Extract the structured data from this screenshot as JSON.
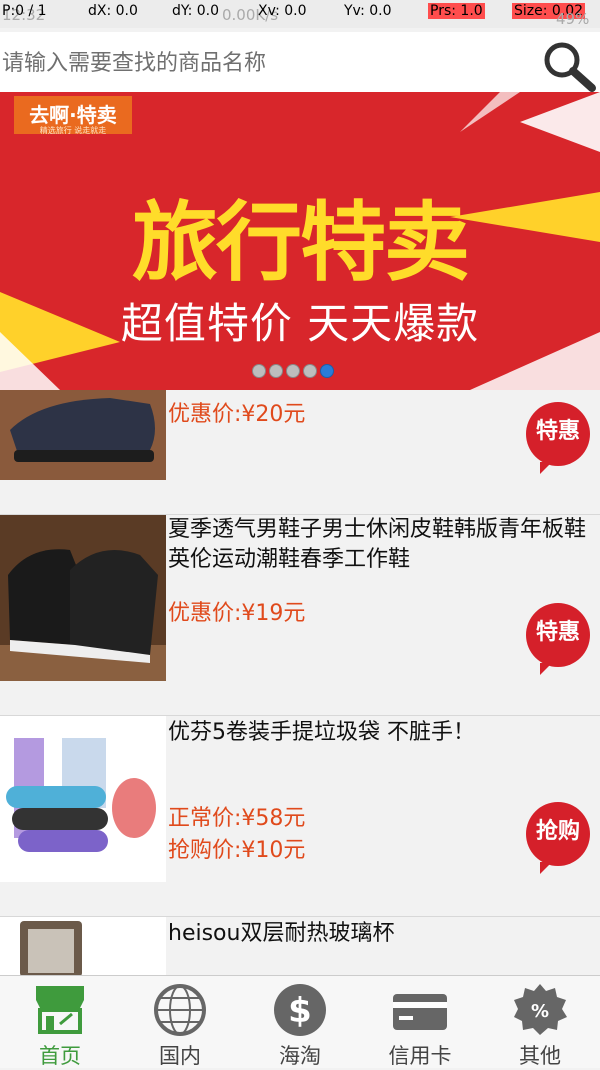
{
  "status_bar": {
    "p": "P:0 / 1",
    "dx": "dX: 0.0",
    "dy": "dY: 0.0",
    "xv": "Xv: 0.0",
    "yv": "Yv: 0.0",
    "prs": "Prs: 1.0",
    "size": "Size: 0.02",
    "time": "12:32",
    "net": "0.00K/s",
    "battery": "49%"
  },
  "search": {
    "placeholder": "请输入需要查找的商品名称"
  },
  "banner": {
    "logo": "去啊·特卖",
    "logo_sub": "精选旅行 说走就走",
    "title": "旅行特卖",
    "subtitle": "超值特价 天天爆款",
    "dots": 5,
    "active_dot": 5
  },
  "items": [
    {
      "name": "",
      "price1": "优惠价:¥20元",
      "price2": "",
      "badge": "特惠"
    },
    {
      "name": "夏季透气男鞋子男士休闲皮鞋韩版青年板鞋英伦运动潮鞋春季工作鞋",
      "price1": "优惠价:¥19元",
      "price2": "",
      "badge": "特惠"
    },
    {
      "name": "优芬5卷装手提垃圾袋 不脏手！",
      "price1": "正常价:¥58元",
      "price2": "抢购价:¥10元",
      "badge": "抢购"
    },
    {
      "name": "heisou双层耐热玻璃杯",
      "price1": "",
      "price2": "",
      "badge": ""
    }
  ],
  "tabs": [
    {
      "label": "首页",
      "icon": "store-icon",
      "active": true
    },
    {
      "label": "国内",
      "icon": "globe-icon",
      "active": false
    },
    {
      "label": "海淘",
      "icon": "dollar-icon",
      "active": false
    },
    {
      "label": "信用卡",
      "icon": "credit-card-icon",
      "active": false
    },
    {
      "label": "其他",
      "icon": "percent-badge-icon",
      "active": false
    }
  ],
  "colors": {
    "accent": "#3f9b3d",
    "price": "#e04a1c",
    "badge": "#d5202a",
    "banner": "#d8262b"
  }
}
